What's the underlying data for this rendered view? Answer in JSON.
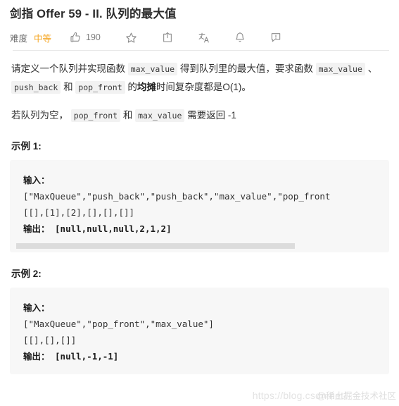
{
  "header": {
    "title": "剑指 Offer 59 - II. 队列的最大值",
    "difficulty_label": "难度",
    "difficulty_value": "中等",
    "like_count": "190",
    "accent_color": "#f5a623",
    "icons": [
      {
        "name": "thumbs-up-icon",
        "label": "点赞"
      },
      {
        "name": "star-icon",
        "label": "收藏"
      },
      {
        "name": "share-icon",
        "label": "分享"
      },
      {
        "name": "translate-icon",
        "label": "切换语言"
      },
      {
        "name": "bell-icon",
        "label": "提醒"
      },
      {
        "name": "feedback-icon",
        "label": "反馈"
      }
    ]
  },
  "description": {
    "p1_part1": "请定义一个队列并实现函数 ",
    "p1_code1": "max_value",
    "p1_part2": " 得到队列里的最大值，要求函数 ",
    "p1_code2": "max_value",
    "p1_part3": " 、 ",
    "p1_code3": "push_back",
    "p1_part4": " 和 ",
    "p1_code4": "pop_front",
    "p1_part5": " 的",
    "p1_bold": "均摊",
    "p1_part6": "时间复杂度都是O(1)。",
    "p2_part1": "若队列为空， ",
    "p2_code1": "pop_front",
    "p2_part2": " 和 ",
    "p2_code2": "max_value",
    "p2_part3": " 需要返回 -1"
  },
  "examples": [
    {
      "title": "示例 1:",
      "input_label": "输入：",
      "input_line1": "[\"MaxQueue\",\"push_back\",\"push_back\",\"max_value\",\"pop_front",
      "input_line2": "[[],[1],[2],[],[],[]]",
      "output_line": "输出： [null,null,null,2,1,2]",
      "has_scrollbar": true
    },
    {
      "title": "示例 2:",
      "input_label": "输入：",
      "input_line1": "[\"MaxQueue\",\"pop_front\",\"max_value\"]",
      "input_line2": "[[],[],[]]",
      "output_line": "输出： [null,-1,-1]",
      "has_scrollbar": false
    }
  ],
  "watermark": {
    "url": "https://blog.csdn.net/",
    "tag": "@稀土掘金技术社区"
  }
}
